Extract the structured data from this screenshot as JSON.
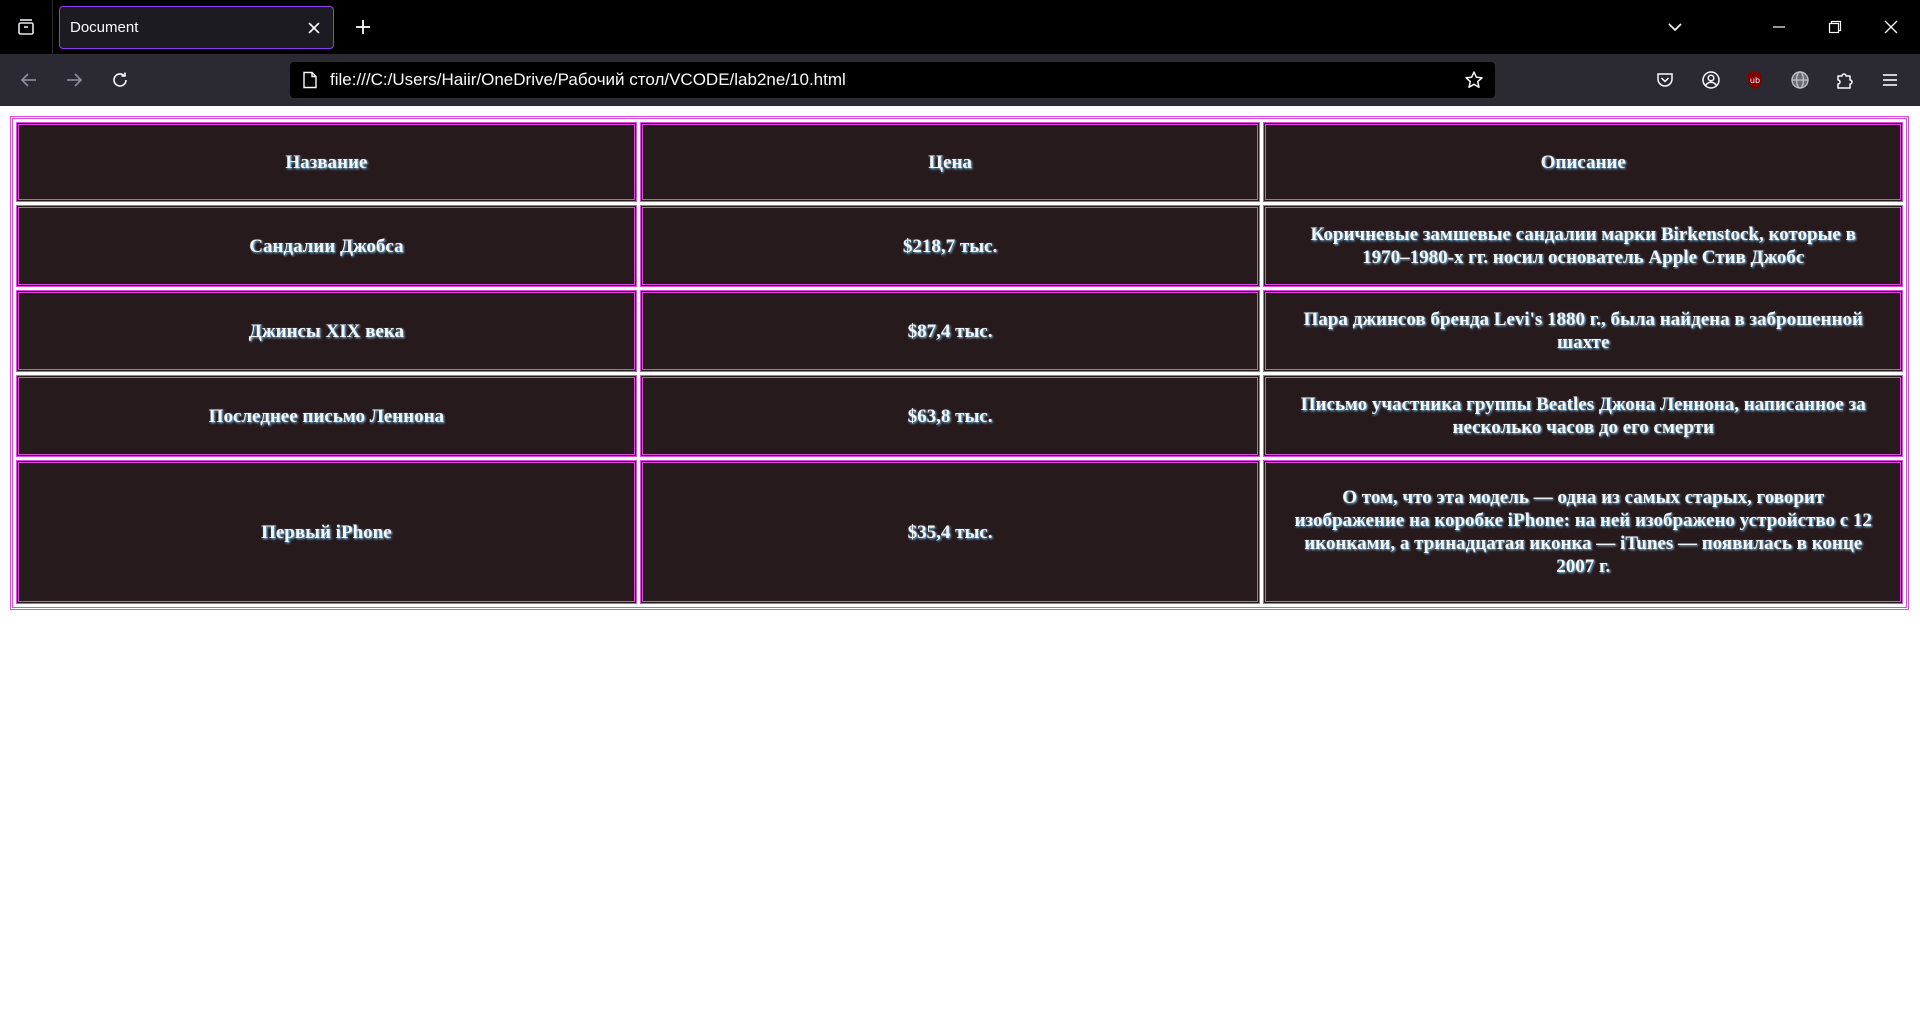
{
  "browser": {
    "tab_title": "Document",
    "url": "file:///C:/Users/Haiir/OneDrive/Рабочий стол/VCODE/lab2ne/10.html",
    "accent_color": "#8a3cf0"
  },
  "table": {
    "headers": [
      "Название",
      "Цена",
      "Описание"
    ],
    "rows": [
      {
        "name": "Сандалии Джобса",
        "price": "$218,7 тыс.",
        "description": "Коричневые замшевые сандалии марки Birkenstock, которые в 1970–1980-х гг. носил основатель Apple Стив Джобс"
      },
      {
        "name": "Джинсы XIX века",
        "price": "$87,4 тыс.",
        "description": "Пара джинсов бренда Levi's 1880 г., была найдена в заброшенной шахте"
      },
      {
        "name": "Последнее письмо Леннона",
        "price": "$63,8 тыс.",
        "description": "Письмо участника группы Beatles Джона Леннона, написанное за несколько часов до его смерти"
      },
      {
        "name": "Первый iPhone",
        "price": "$35,4 тыс.",
        "description": "О том, что эта модель — одна из самых старых, говорит изображение на коробке iPhone: на ней изображено устройство с 12 иконками, а тринадцатая иконка — iTunes — появилась в конце 2007 г."
      }
    ],
    "colors": {
      "cell_background": "#271a1d",
      "border": "#e048e0",
      "text": "#f4f4f4",
      "text_shadow": "#7fd3ff"
    }
  }
}
